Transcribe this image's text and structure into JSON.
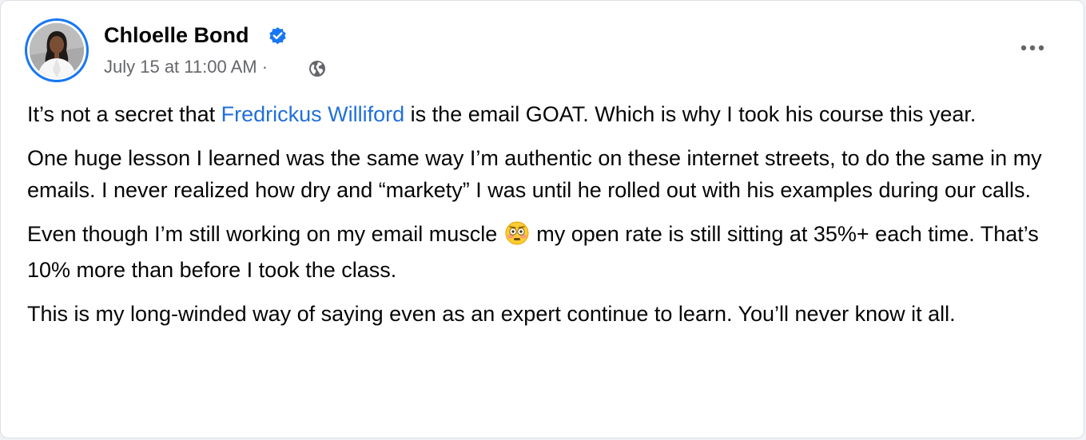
{
  "post": {
    "author": {
      "name": "Chloelle Bond",
      "verified": true,
      "avatar_icon": "profile-photo"
    },
    "timestamp": "July 15 at 11:00 AM",
    "separator": " · ",
    "audience_icon": "globe-icon",
    "more_icon": "more-horizontal-icon",
    "paragraphs": [
      {
        "before_mention": "It’s not a secret that ",
        "mention": "Fredrickus Williford",
        "after_mention": " is the email GOAT. Which is why I took his course this year."
      },
      {
        "text": "One huge lesson I learned was the same way I’m authentic on these internet streets, to do the same in my emails. I never realized how dry and “markety” I was until he rolled out with his examples during our calls."
      },
      {
        "before_emoji": "Even though I’m still working on my email muscle ",
        "emoji": "😳",
        "after_emoji": " my open rate is still sitting at 35%+ each time. That’s 10% more than before I took the class."
      },
      {
        "text": "This is my long-winded way of saying even as an expert continue to learn. You’ll never know it all."
      }
    ]
  },
  "colors": {
    "link": "#216fdb",
    "verified_badge": "#1877f2",
    "text": "#050505",
    "secondary_text": "#65676b"
  }
}
